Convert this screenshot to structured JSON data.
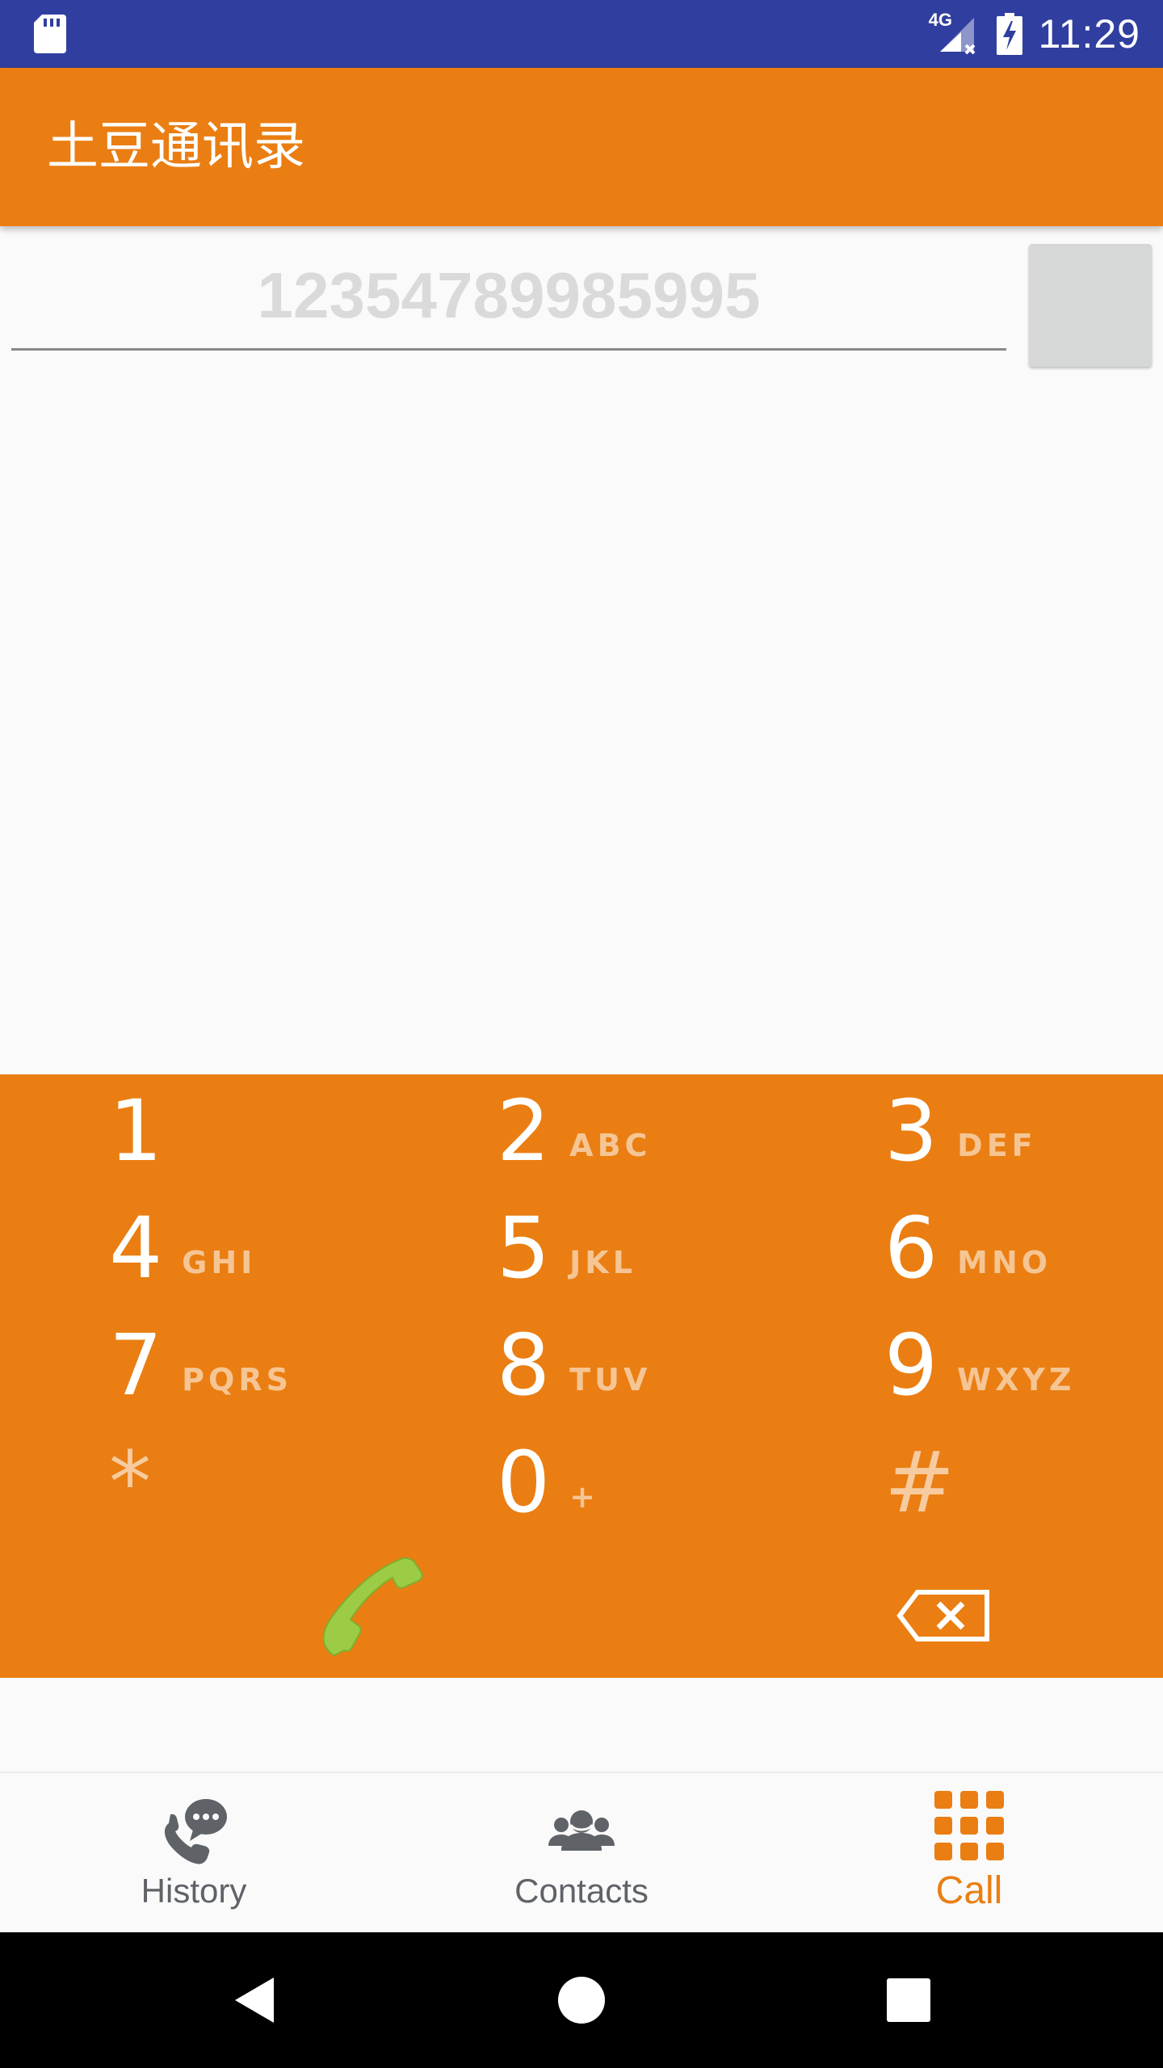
{
  "status_bar": {
    "network": "4G",
    "time": "11:29"
  },
  "app_bar": {
    "title": "土豆通讯录"
  },
  "dial_input": {
    "value": "12354789985995"
  },
  "keypad": {
    "keys": [
      {
        "digit": "1",
        "letters": ""
      },
      {
        "digit": "2",
        "letters": "ABC"
      },
      {
        "digit": "3",
        "letters": "DEF"
      },
      {
        "digit": "4",
        "letters": "GHI"
      },
      {
        "digit": "5",
        "letters": "JKL"
      },
      {
        "digit": "6",
        "letters": "MNO"
      },
      {
        "digit": "7",
        "letters": "PQRS"
      },
      {
        "digit": "8",
        "letters": "TUV"
      },
      {
        "digit": "9",
        "letters": "WXYZ"
      },
      {
        "digit": "*",
        "letters": ""
      },
      {
        "digit": "0",
        "letters": "+"
      },
      {
        "digit": "#",
        "letters": ""
      }
    ],
    "call_icon": "phone-handset-icon",
    "backspace_icon": "backspace-icon"
  },
  "bottom_nav": {
    "items": [
      {
        "label": "History",
        "icon": "phone-chat-icon",
        "active": false
      },
      {
        "label": "Contacts",
        "icon": "group-icon",
        "active": false
      },
      {
        "label": "Call",
        "icon": "dialpad-icon",
        "active": true
      }
    ]
  },
  "colors": {
    "accent": "#ea7e12",
    "status_bar": "#303f9f",
    "call_green": "#9ccc45"
  }
}
